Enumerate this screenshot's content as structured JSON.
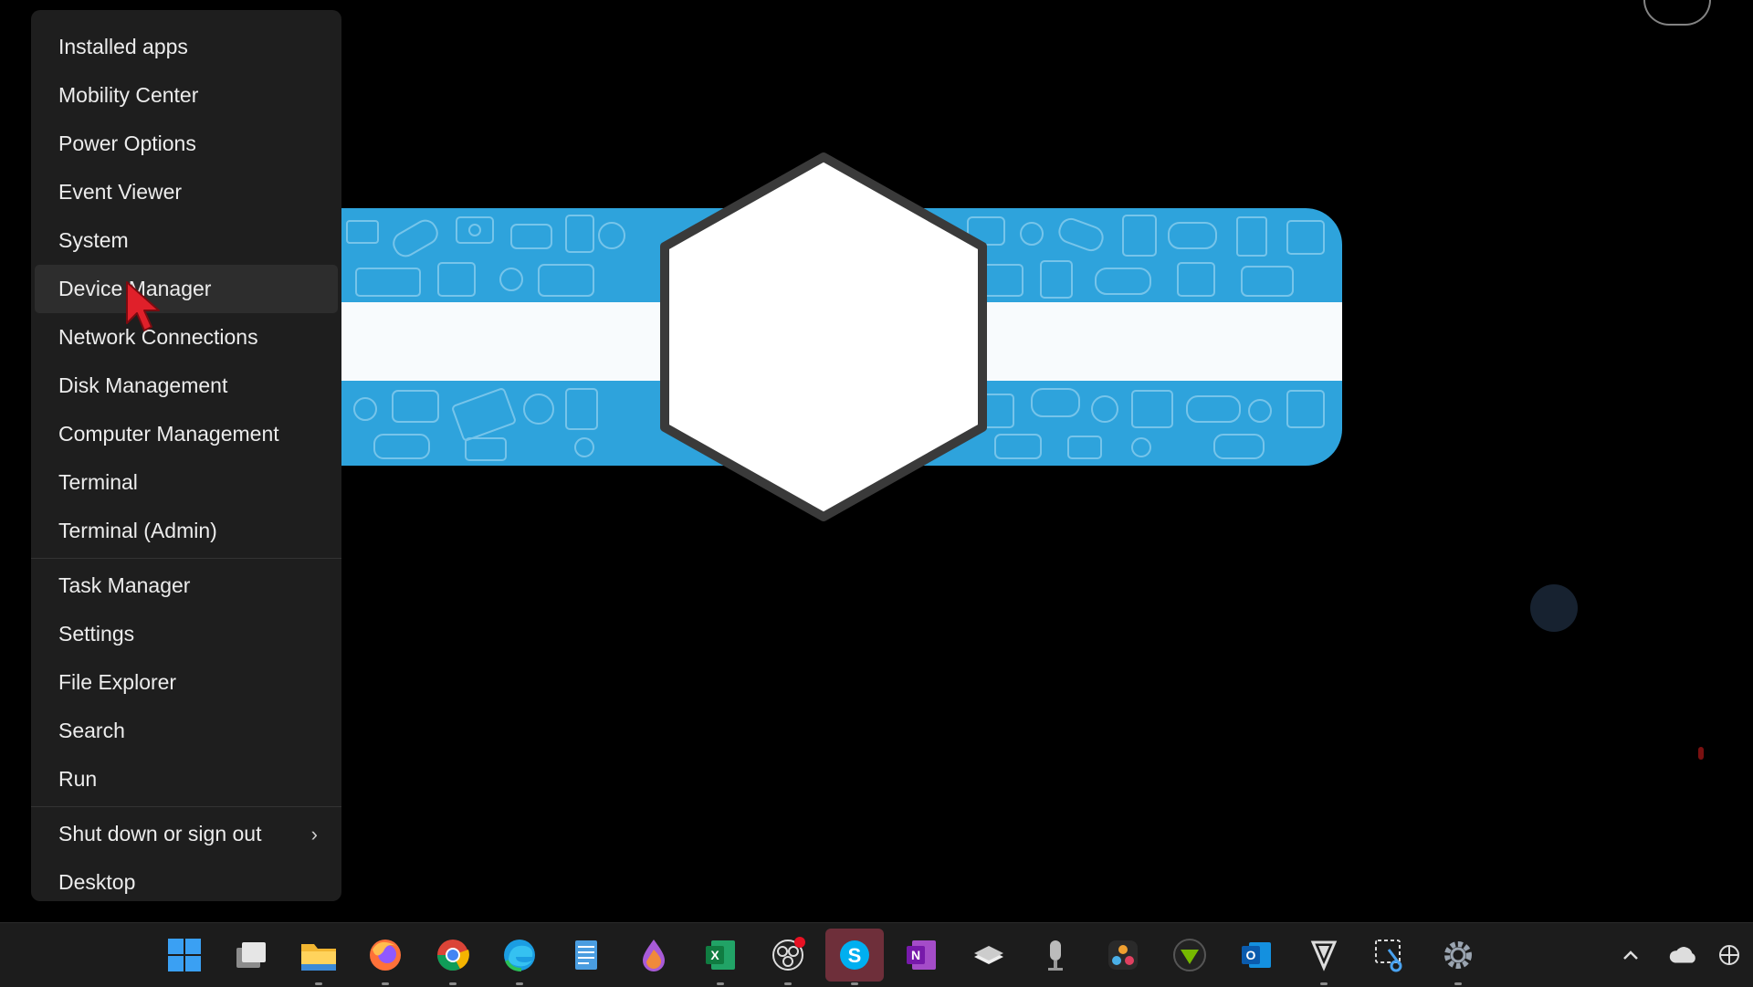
{
  "context_menu": {
    "group1": [
      {
        "label": "Installed apps",
        "name": "menu-item-installed-apps"
      },
      {
        "label": "Mobility Center",
        "name": "menu-item-mobility-center"
      },
      {
        "label": "Power Options",
        "name": "menu-item-power-options"
      },
      {
        "label": "Event Viewer",
        "name": "menu-item-event-viewer"
      },
      {
        "label": "System",
        "name": "menu-item-system"
      },
      {
        "label": "Device Manager",
        "name": "menu-item-device-manager",
        "hovered": true
      },
      {
        "label": "Network Connections",
        "name": "menu-item-network-connections"
      },
      {
        "label": "Disk Management",
        "name": "menu-item-disk-management"
      },
      {
        "label": "Computer Management",
        "name": "menu-item-computer-management"
      },
      {
        "label": "Terminal",
        "name": "menu-item-terminal"
      },
      {
        "label": "Terminal (Admin)",
        "name": "menu-item-terminal-admin"
      }
    ],
    "group2": [
      {
        "label": "Task Manager",
        "name": "menu-item-task-manager"
      },
      {
        "label": "Settings",
        "name": "menu-item-settings"
      },
      {
        "label": "File Explorer",
        "name": "menu-item-file-explorer"
      },
      {
        "label": "Search",
        "name": "menu-item-search"
      },
      {
        "label": "Run",
        "name": "menu-item-run"
      }
    ],
    "group3": [
      {
        "label": "Shut down or sign out",
        "name": "menu-item-shut-down",
        "submenu": true
      },
      {
        "label": "Desktop",
        "name": "menu-item-desktop"
      }
    ],
    "submenu_chevron": "›"
  },
  "taskbar": {
    "apps": [
      {
        "icon": "windows-start-icon"
      },
      {
        "icon": "task-view-icon"
      },
      {
        "icon": "file-explorer-icon",
        "running": true
      },
      {
        "icon": "firefox-icon",
        "running": true
      },
      {
        "icon": "chrome-icon",
        "running": true
      },
      {
        "icon": "edge-icon",
        "running": true
      },
      {
        "icon": "notepad-icon"
      },
      {
        "icon": "paint-drop-icon"
      },
      {
        "icon": "excel-icon",
        "running": true
      },
      {
        "icon": "obs-icon",
        "running": true
      },
      {
        "icon": "skype-icon",
        "running": true,
        "active": true
      },
      {
        "icon": "onenote-icon"
      },
      {
        "icon": "stack-app-icon"
      },
      {
        "icon": "microphone-icon"
      },
      {
        "icon": "davinci-resolve-icon"
      },
      {
        "icon": "nvidia-shield-icon"
      },
      {
        "icon": "outlook-icon"
      },
      {
        "icon": "vpn-shield-icon",
        "running": true
      },
      {
        "icon": "snipping-tool-icon"
      },
      {
        "icon": "settings-gear-icon",
        "running": true
      }
    ],
    "tray": [
      {
        "icon": "chevron-up-icon"
      },
      {
        "icon": "onedrive-cloud-icon"
      },
      {
        "icon": "network-icon"
      }
    ]
  },
  "colors": {
    "menu_bg": "#1e1e1e",
    "menu_hover": "#2d2d2d",
    "banner_blue": "#2ea3dc",
    "taskbar_bg": "#1c1c1c",
    "active_app_bg": "#6e2f3a",
    "cursor_red": "#e0202a"
  }
}
